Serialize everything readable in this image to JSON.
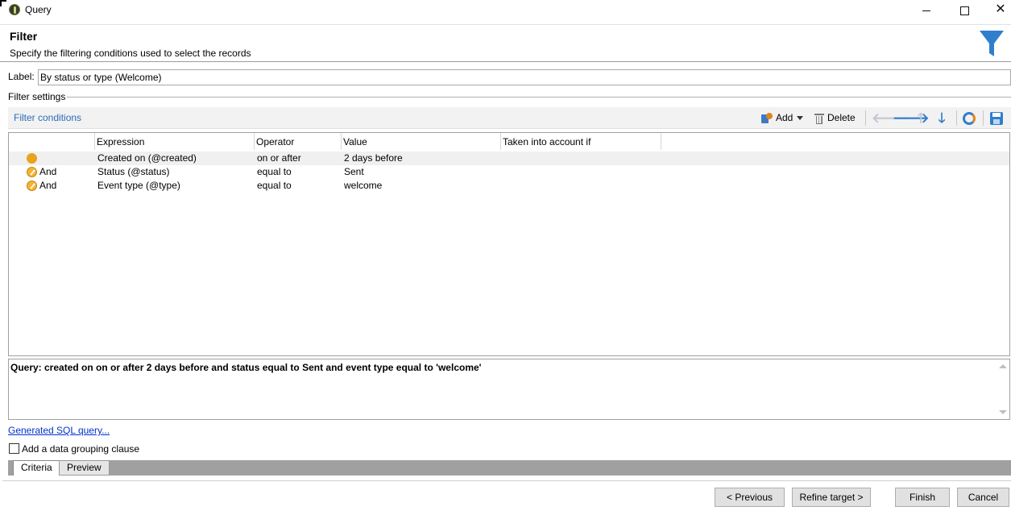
{
  "window": {
    "title": "Query"
  },
  "header": {
    "title": "Filter",
    "subtitle": "Specify the filtering conditions used to select the records"
  },
  "label_field": {
    "label": "Label:",
    "value": "By status or type (Welcome)"
  },
  "filter_settings": {
    "title": "Filter settings"
  },
  "toolbar": {
    "section_title": "Filter conditions",
    "add_label": "Add",
    "delete_label": "Delete"
  },
  "grid": {
    "columns": [
      "Expression",
      "Operator",
      "Value",
      "Taken into account if"
    ],
    "rows": [
      {
        "logic": "",
        "expression": "Created on (@created)",
        "operator": "on or after",
        "value": "2 days before",
        "taken_into_account_if": ""
      },
      {
        "logic": "And",
        "expression": "Status (@status)",
        "operator": "equal to",
        "value": "Sent",
        "taken_into_account_if": ""
      },
      {
        "logic": "And",
        "expression": "Event type (@type)",
        "operator": "equal to",
        "value": "welcome",
        "taken_into_account_if": ""
      }
    ]
  },
  "query": {
    "text": "Query: created on on or after 2 days before and status equal to Sent and event type equal to 'welcome'"
  },
  "sql_link": "Generated SQL query...",
  "grouping": {
    "label": "Add a data grouping clause",
    "checked": false
  },
  "tabs": [
    "Criteria",
    "Preview"
  ],
  "buttons": {
    "previous": "< Previous",
    "refine": "Refine target >",
    "finish": "Finish",
    "cancel": "Cancel"
  },
  "colors": {
    "accent_blue": "#2f7fcc",
    "link_blue": "#2a6cb8",
    "status_orange": "#e9a21c"
  }
}
